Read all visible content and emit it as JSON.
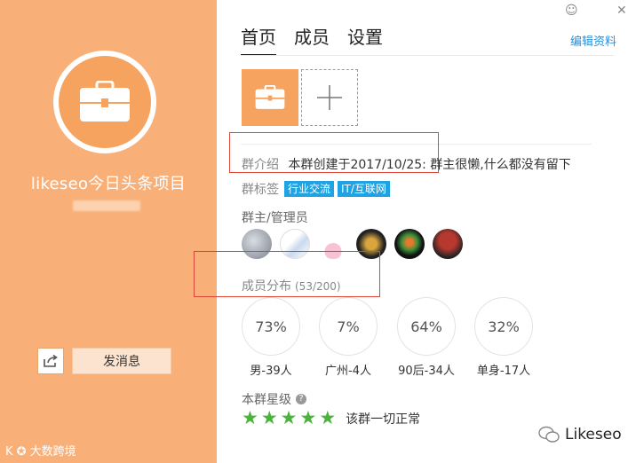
{
  "window": {
    "skin_label": "☺",
    "close_label": "✕"
  },
  "left_panel": {
    "group_name": "likeseo今日头条项目",
    "send_button": "发消息",
    "watermark": "K ✪ 大数跨境"
  },
  "tabs": [
    {
      "label": "首页",
      "active": true
    },
    {
      "label": "成员",
      "active": false
    },
    {
      "label": "设置",
      "active": false
    }
  ],
  "edit_link": "编辑资料",
  "intro": {
    "label": "群介绍",
    "text": "本群创建于2017/10/25: 群主很懒,什么都没有留下"
  },
  "tags": {
    "label": "群标签",
    "items": [
      "行业交流",
      "IT/互联网"
    ]
  },
  "admins": {
    "label": "群主/管理员",
    "count": 6
  },
  "members": {
    "label": "成员分布",
    "count": "(53/200)"
  },
  "stats": [
    {
      "percent": "73%",
      "label": "男-39人"
    },
    {
      "percent": "7%",
      "label": "广州-4人"
    },
    {
      "percent": "64%",
      "label": "90后-34人"
    },
    {
      "percent": "32%",
      "label": "单身-17人"
    }
  ],
  "rating": {
    "label": "本群星级",
    "help": "?",
    "stars": 5,
    "status": "该群一切正常"
  },
  "watermark_right": "Likeseo",
  "colors": {
    "panel": "#f9b078",
    "accent": "#f5a35f",
    "tag": "#1fa3e3",
    "star": "#49b33c",
    "highlight": "#e0453a"
  }
}
